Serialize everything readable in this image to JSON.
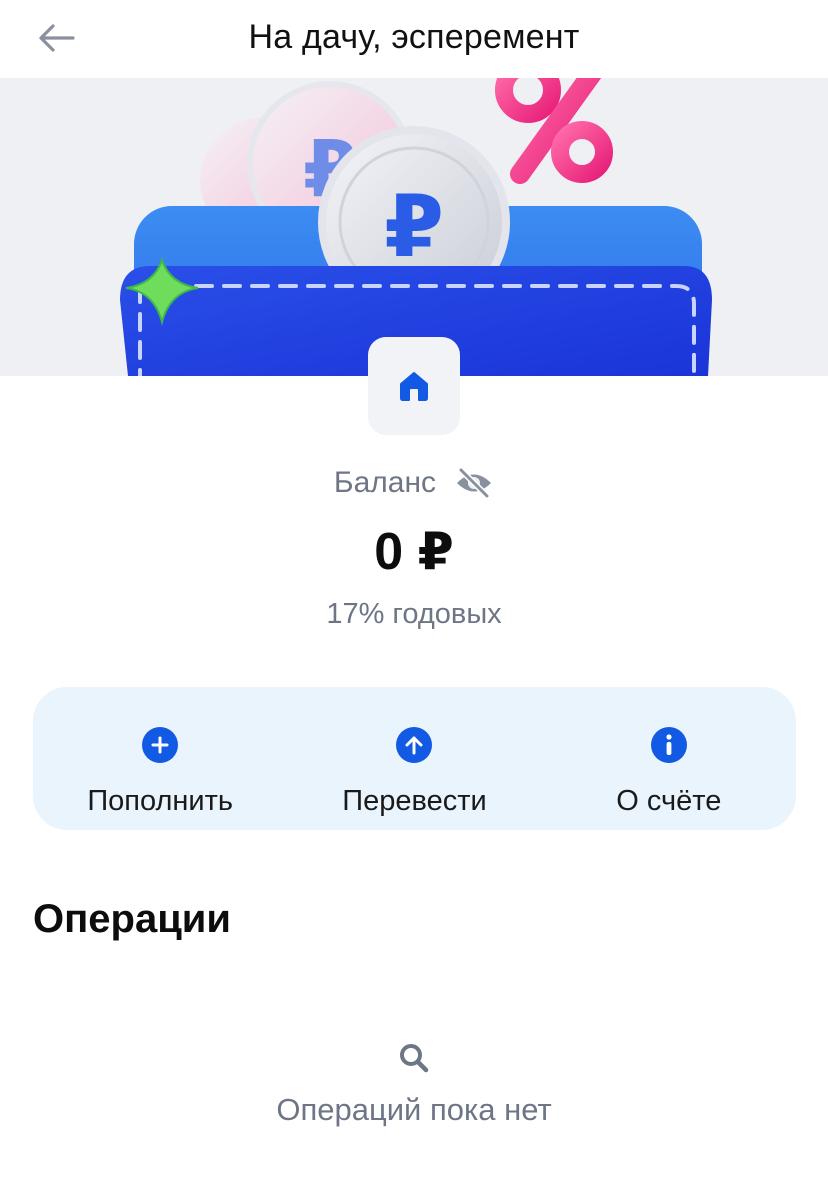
{
  "header": {
    "title": "На дачу, эсперемент",
    "back_icon": "arrow-left-icon"
  },
  "banner": {
    "illustration": "wallet-with-ruble-coins-and-percent",
    "colors": {
      "wallet": "#1f3fe0",
      "coins": "#d9dbe3",
      "percent": "#ff3d8b",
      "star": "#5bd26a"
    }
  },
  "account": {
    "icon": "house-icon"
  },
  "balance": {
    "label": "Баланс",
    "visibility_icon": "eye-off-icon",
    "amount": "0 ₽",
    "rate": "17% годовых"
  },
  "actions": [
    {
      "label": "Пополнить",
      "icon": "plus-circle-icon"
    },
    {
      "label": "Перевести",
      "icon": "arrow-up-circle-icon"
    },
    {
      "label": "О счёте",
      "icon": "info-circle-icon"
    }
  ],
  "operations": {
    "title": "Операции",
    "empty_icon": "search-icon",
    "empty_text": "Операций пока нет"
  },
  "colors": {
    "accent": "#1259e3",
    "muted_text": "#6e7686",
    "actions_bg": "#e9f4fd"
  }
}
